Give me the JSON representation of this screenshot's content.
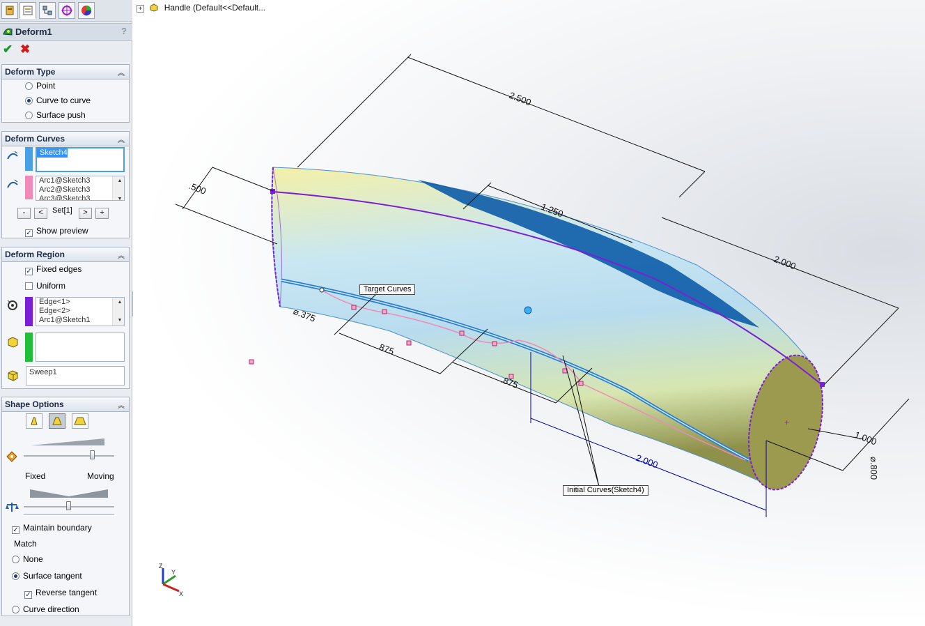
{
  "property_manager": {
    "title": "Deform1",
    "help_label": "?",
    "ok_label": "✔",
    "cancel_label": "✖",
    "deform_type": {
      "header": "Deform Type",
      "options": [
        "Point",
        "Curve to curve",
        "Surface push"
      ],
      "selected": "Curve to curve"
    },
    "deform_curves": {
      "header": "Deform Curves",
      "initial_curves": [
        "Sketch4"
      ],
      "target_curves": [
        "Arc1@Sketch3",
        "Arc2@Sketch3",
        "Arc3@Sketch3"
      ],
      "set_label": "Set[1]",
      "btn_minus": "-",
      "btn_prev": "<",
      "btn_next": ">",
      "btn_plus": "+",
      "show_preview": "Show preview"
    },
    "deform_region": {
      "header": "Deform Region",
      "fixed_edges": "Fixed edges",
      "uniform": "Uniform",
      "edges": [
        "Edge<1>",
        "Edge<2>",
        "Arc1@Sketch1"
      ],
      "body": "Sweep1"
    },
    "shape_options": {
      "header": "Shape Options",
      "label_fixed": "Fixed",
      "label_moving": "Moving",
      "maintain_boundary": "Maintain boundary",
      "match_label": "Match",
      "match_options": [
        "None",
        "Surface tangent"
      ],
      "match_selected": "Surface tangent",
      "reverse_tangent": "Reverse tangent",
      "curve_direction": "Curve direction"
    }
  },
  "viewport": {
    "tree_item": "Handle  (Default<<Default...",
    "callout_target": "Target Curves",
    "callout_initial": "Initial Curves(Sketch4)",
    "dimensions": {
      "d2500": "2.500",
      "d500": ".500",
      "d1250": "1.250",
      "d2000_top": "2.000",
      "d375": "⌀.375",
      "d875a": ".875",
      "d875b": ".875",
      "d2000_bottom": "2.000",
      "d1000": "1.000",
      "ddia": "⌀.800"
    },
    "triad": {
      "x": "X",
      "y": "Y",
      "z": "Z"
    },
    "colors": {
      "blue_dim": "#0000a0",
      "purple_edge": "#7a1fd6",
      "accent_blue": "#2a7fd0"
    }
  }
}
